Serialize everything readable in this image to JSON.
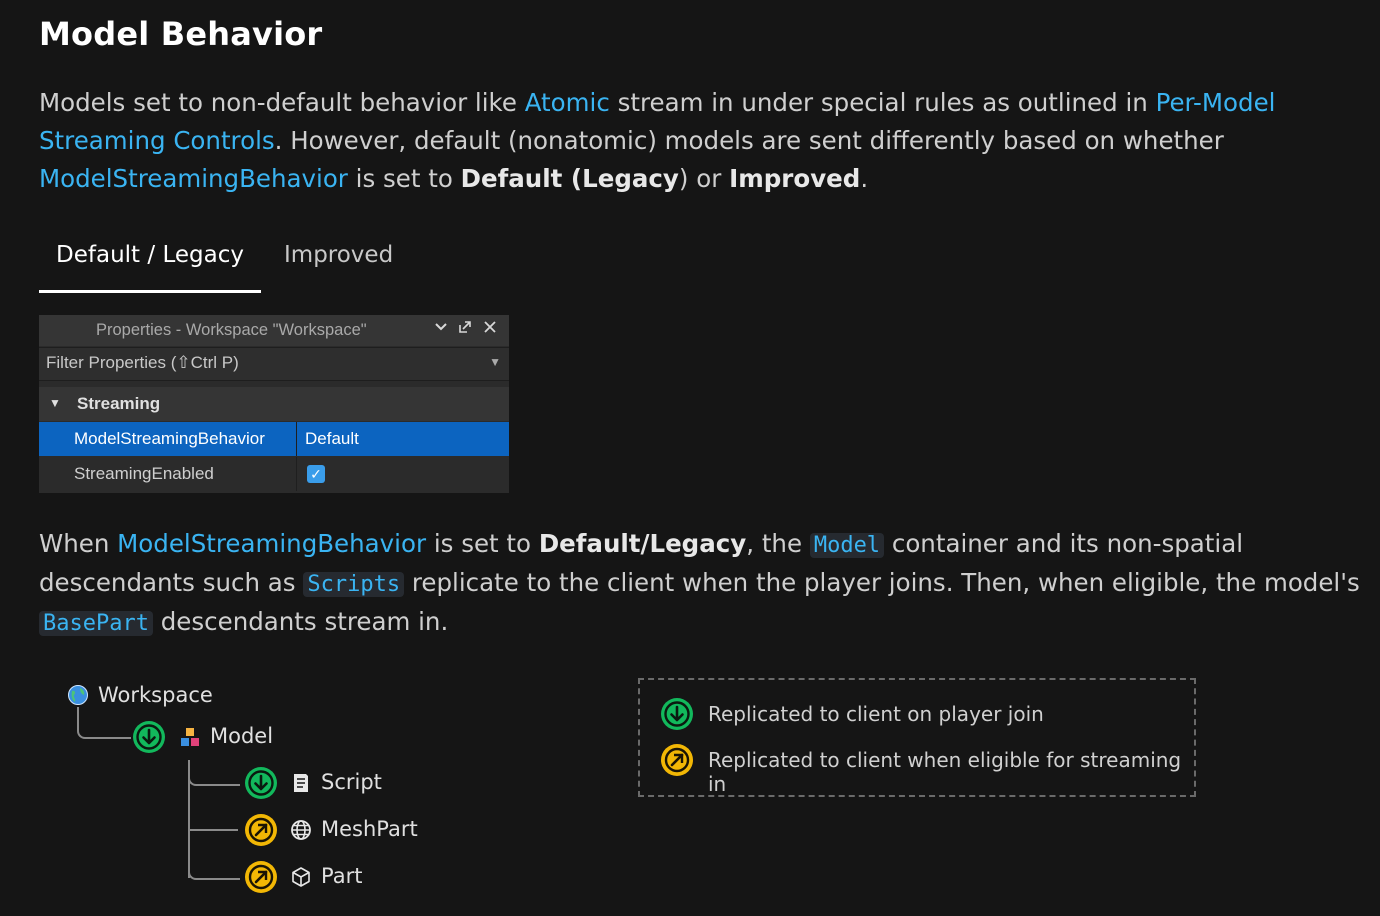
{
  "page": {
    "title": "Model Behavior",
    "intro": {
      "t1": "Models set to non-default behavior like ",
      "link_atomic": "Atomic",
      "t2": " stream in under special rules as outlined in ",
      "link_per_model": "Per-Model Streaming Controls",
      "t3": ". However, default (nonatomic) models are sent differently based on whether ",
      "link_msb": "ModelStreamingBehavior",
      "t4": " is set to ",
      "bold_default": "Default",
      "t5": " (",
      "bold_legacy": "Legacy",
      "t6": ") or ",
      "bold_improved": "Improved",
      "t7": "."
    }
  },
  "tabs": [
    {
      "label": "Default / Legacy",
      "active": true
    },
    {
      "label": "Improved",
      "active": false
    }
  ],
  "properties_panel": {
    "title": "Properties - Workspace \"Workspace\"",
    "filter_placeholder": "Filter Properties (⇧Ctrl P)",
    "group": "Streaming",
    "rows": [
      {
        "name": "ModelStreamingBehavior",
        "value": "Default",
        "selected": true
      },
      {
        "name": "StreamingEnabled",
        "value_checked": true,
        "selected": false
      }
    ]
  },
  "body": {
    "t1": "When ",
    "link_msb": "ModelStreamingBehavior",
    "t2": " is set to ",
    "bold_default_legacy": "Default/Legacy",
    "t3": ", the ",
    "code_model": "Model",
    "t4": " container and its non-spatial descendants such as ",
    "code_scripts": "Scripts",
    "t5": " replicate to the client when the player joins. Then, when eligible, the model's ",
    "code_basepart": "BasePart",
    "t6": " descendants stream in."
  },
  "tree": {
    "root": "Workspace",
    "model": "Model",
    "children": [
      "Script",
      "MeshPart",
      "Part"
    ]
  },
  "legend": {
    "join": "Replicated to client on player join",
    "streaming": "Replicated to client when eligible for streaming in"
  },
  "colors": {
    "background": "#151515",
    "link": "#3ab4f2",
    "selection": "#0c64c0",
    "join_green": "#12b85c",
    "stream_yellow": "#f2b705"
  }
}
